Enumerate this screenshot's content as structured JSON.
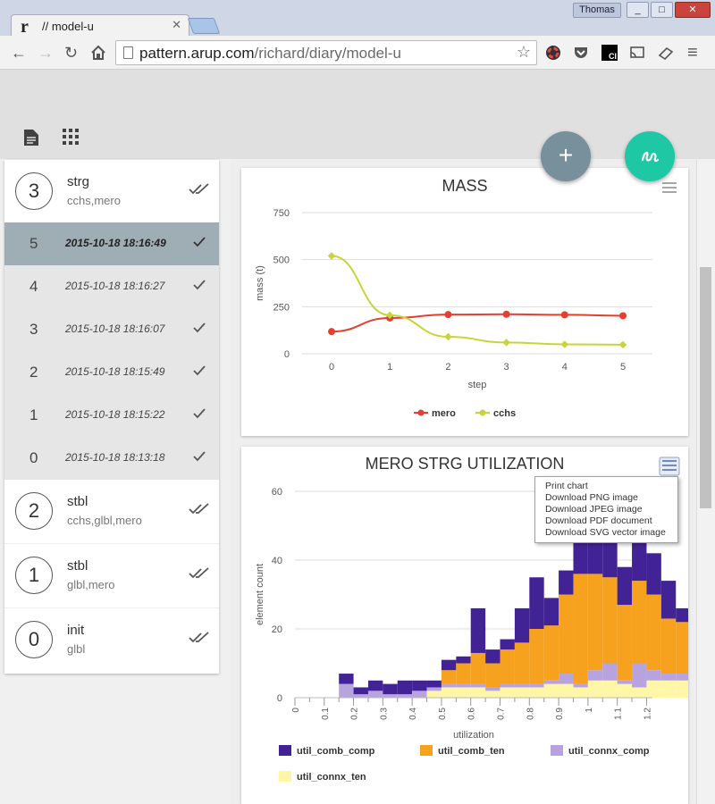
{
  "browser": {
    "tab_title": "// model-u",
    "tab_logo": "r",
    "user": "Thomas",
    "url_host": "pattern.arup.com",
    "url_path": "/richard/diary/model-u",
    "ext_label": "CI"
  },
  "sidebar": {
    "items": [
      {
        "index": "3",
        "title": "strg",
        "subtitle": "cchs,mero"
      },
      {
        "index": "2",
        "title": "stbl",
        "subtitle": "cchs,glbl,mero"
      },
      {
        "index": "1",
        "title": "stbl",
        "subtitle": "glbl,mero"
      },
      {
        "index": "0",
        "title": "init",
        "subtitle": "glbl"
      }
    ],
    "steps": [
      {
        "index": "5",
        "date": "2015-10-18 18:16:49"
      },
      {
        "index": "4",
        "date": "2015-10-18 18:16:27"
      },
      {
        "index": "3",
        "date": "2015-10-18 18:16:07"
      },
      {
        "index": "2",
        "date": "2015-10-18 18:15:49"
      },
      {
        "index": "1",
        "date": "2015-10-18 18:15:22"
      },
      {
        "index": "0",
        "date": "2015-10-18 18:13:18"
      }
    ]
  },
  "colors": {
    "mero": "#e53f31",
    "cchs": "#c7d43a",
    "comb_comp": "#422396",
    "comb_ten": "#f6a21e",
    "connx_comp": "#b7a3de",
    "connx_ten": "#fff6a8"
  },
  "export_menu": [
    "Print chart",
    "Download PNG image",
    "Download JPEG image",
    "Download PDF document",
    "Download SVG vector image"
  ],
  "chart_data": [
    {
      "type": "line",
      "title": "MASS",
      "xlabel": "step",
      "ylabel": "mass (t)",
      "x": [
        0,
        1,
        2,
        3,
        4,
        5
      ],
      "ylim": [
        0,
        750
      ],
      "yticks": [
        0,
        250,
        500,
        750
      ],
      "legend_position": "bottom",
      "series": [
        {
          "name": "mero",
          "values": [
            118,
            190,
            208,
            210,
            207,
            202
          ]
        },
        {
          "name": "cchs",
          "values": [
            520,
            205,
            90,
            60,
            50,
            48
          ]
        }
      ]
    },
    {
      "type": "bar",
      "stacked": true,
      "title": "MERO STRG UTILIZATION",
      "xlabel": "utilization",
      "ylabel": "element count",
      "ylim": [
        0,
        60
      ],
      "yticks": [
        0,
        20,
        40,
        60
      ],
      "xticks": [
        "0",
        "0.1",
        "0.2",
        "0.3",
        "0.4",
        "0.5",
        "0.6",
        "0.7",
        "0.8",
        "0.9",
        "1",
        "1.1",
        "1.2"
      ],
      "xlim": [
        0,
        1.22
      ],
      "bin_width": 0.05,
      "bins_start": 0.15,
      "legend_position": "bottom",
      "series": [
        {
          "name": "util_connx_ten",
          "values": [
            0,
            0,
            0,
            0,
            0,
            0,
            2,
            3,
            3,
            3,
            2,
            3,
            3,
            3,
            4,
            4,
            3,
            5,
            5,
            4,
            3,
            5,
            5,
            5,
            2,
            4,
            3
          ]
        },
        {
          "name": "util_connx_comp",
          "values": [
            4,
            1,
            2,
            1,
            1,
            2,
            1,
            1,
            1,
            1,
            1,
            1,
            1,
            1,
            1,
            3,
            1,
            3,
            5,
            1,
            7,
            3,
            2,
            2,
            3,
            1,
            4
          ]
        },
        {
          "name": "util_comb_ten",
          "values": [
            0,
            0,
            0,
            0,
            0,
            0,
            0,
            4,
            6,
            9,
            7,
            10,
            12,
            16,
            16,
            23,
            32,
            28,
            25,
            22,
            24,
            22,
            16,
            15,
            15,
            12,
            13
          ]
        },
        {
          "name": "util_comb_comp",
          "values": [
            3,
            2,
            3,
            3,
            4,
            3,
            2,
            3,
            2,
            13,
            4,
            3,
            10,
            15,
            8,
            7,
            17,
            24,
            24,
            11,
            13,
            12,
            11,
            4,
            4,
            5,
            5
          ]
        }
      ]
    }
  ]
}
